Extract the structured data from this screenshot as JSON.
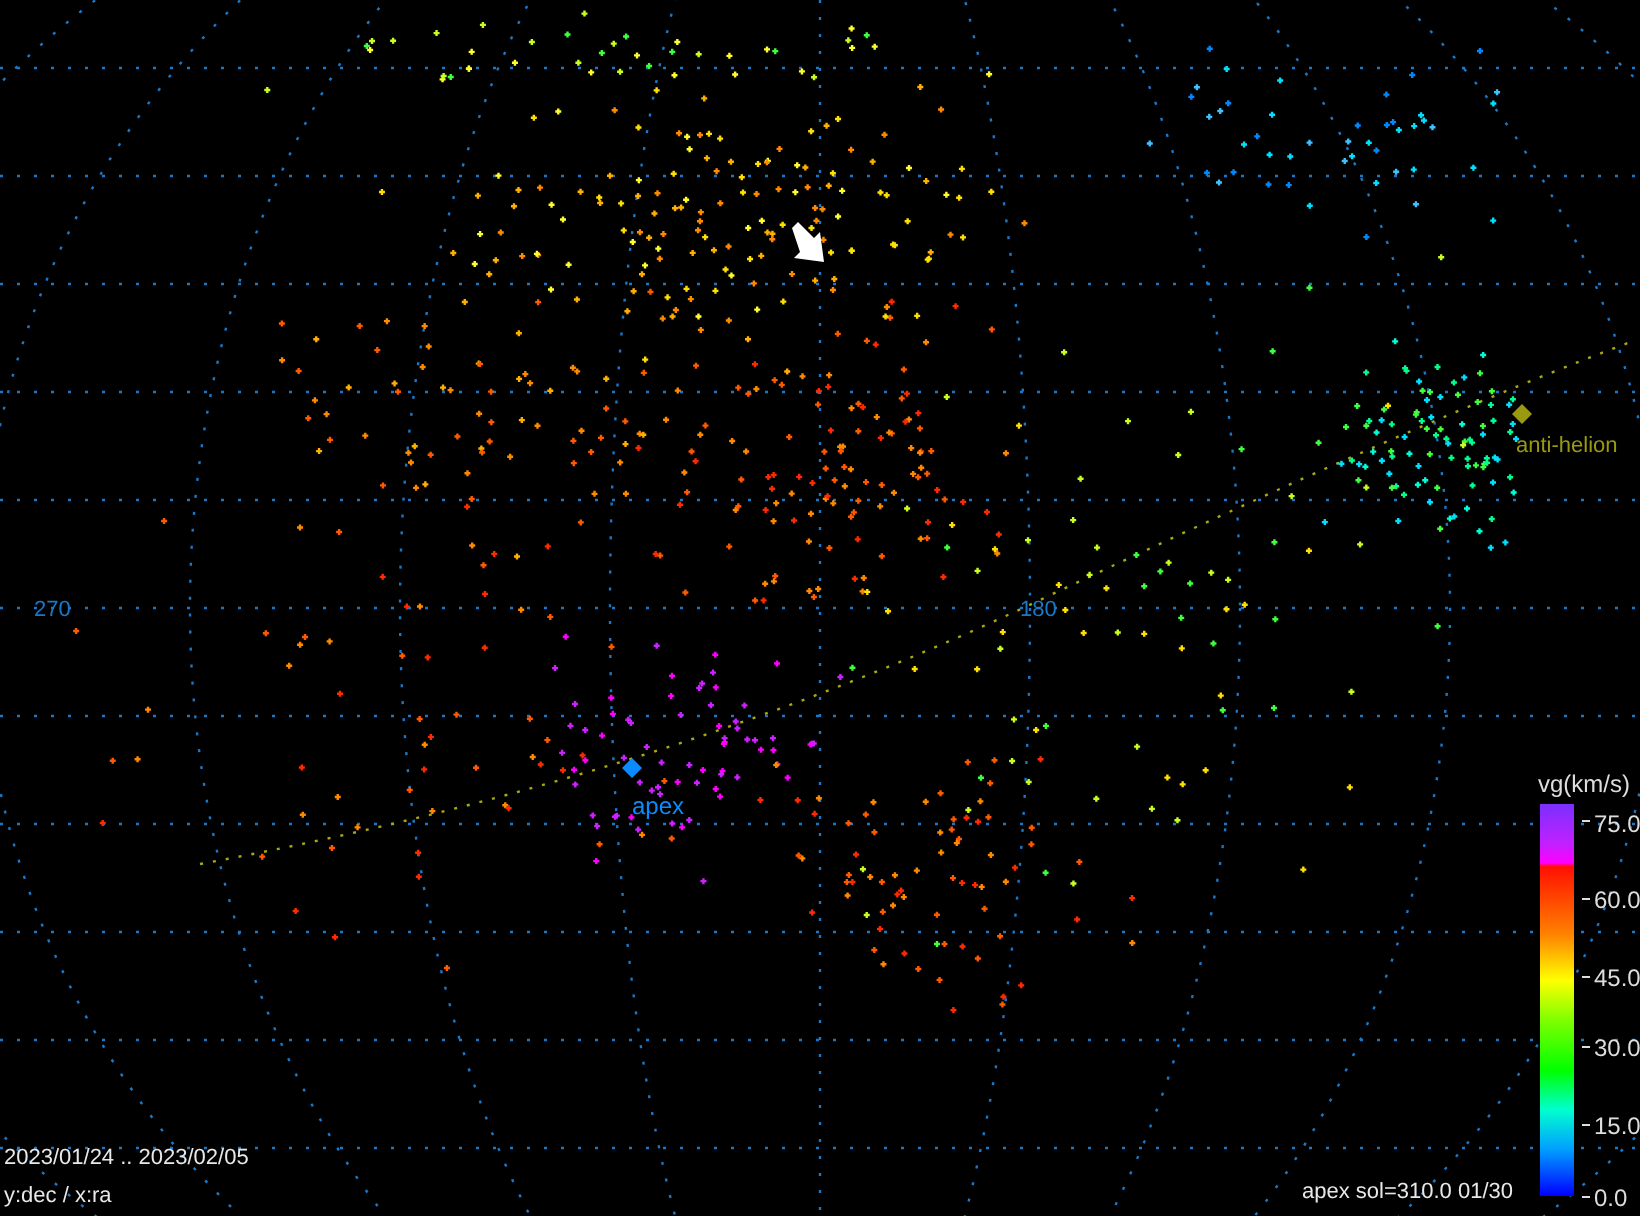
{
  "map": {
    "ra_labels": [
      "270",
      "180"
    ],
    "apex": {
      "label": "apex"
    },
    "anti_helion": {
      "label": "anti-helion"
    }
  },
  "colorbar": {
    "title": "vg(km/s)",
    "ticks": [
      "75.0",
      "60.0",
      "45.0",
      "30.0",
      "15.0",
      "0.0"
    ]
  },
  "footer": {
    "date_range": "2023/01/24 .. 2023/02/05",
    "axes": "y:dec / x:ra",
    "apex_info": "apex sol=310.0 01/30"
  }
}
